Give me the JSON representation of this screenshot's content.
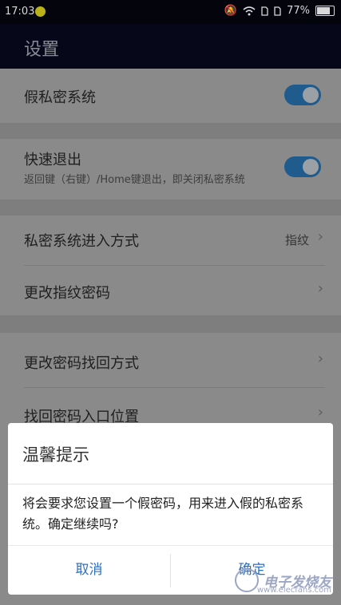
{
  "status_bar": {
    "time": "17:03",
    "battery": "77%"
  },
  "app_bar": {
    "title": "设置"
  },
  "settings": {
    "fake_system": {
      "label": "假私密系统",
      "enabled": true
    },
    "quick_exit": {
      "label": "快速退出",
      "description": "返回键（右键）/Home键退出，即关闭私密系统",
      "enabled": true
    },
    "entry_method": {
      "label": "私密系统进入方式",
      "value": "指纹"
    },
    "change_fingerprint": {
      "label": "更改指纹密码"
    },
    "change_recovery": {
      "label": "更改密码找回方式"
    },
    "recovery_entry": {
      "label": "找回密码入口位置"
    }
  },
  "dialog": {
    "title": "温馨提示",
    "message": "将会要求您设置一个假密码，用来进入假的私密系统。确定继续吗?",
    "cancel_label": "取消",
    "confirm_label": "确定"
  },
  "watermark": {
    "name": "电子发烧友",
    "site": "www.elecfans.com"
  },
  "colors": {
    "toggle_on": "#1f5b8c",
    "dialog_button": "#2a6fc4",
    "app_bar": "#06081a"
  }
}
